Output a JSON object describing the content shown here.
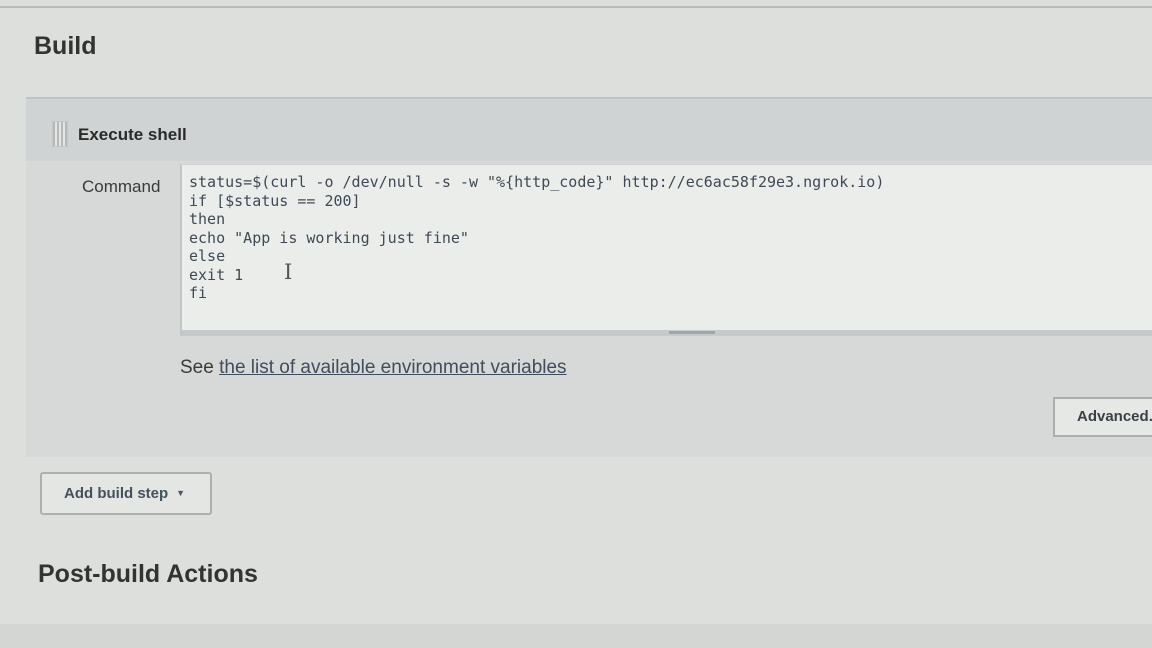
{
  "build_section": {
    "title": "Build"
  },
  "build_step": {
    "title": "Execute shell",
    "command_label": "Command",
    "command_lines": [
      "status=$(curl -o /dev/null -s -w \"%{http_code}\" http://ec6ac58f29e3.ngrok.io)",
      "if [$status == 200]",
      "then",
      "echo \"App is working just fine\"",
      "else",
      "exit 1",
      "fi"
    ],
    "help_prefix": "See",
    "help_link": "the list of available environment variables",
    "advanced_label": "Advanced..."
  },
  "add_build_step": {
    "label": "Add build step"
  },
  "post_build": {
    "title": "Post-build Actions"
  }
}
